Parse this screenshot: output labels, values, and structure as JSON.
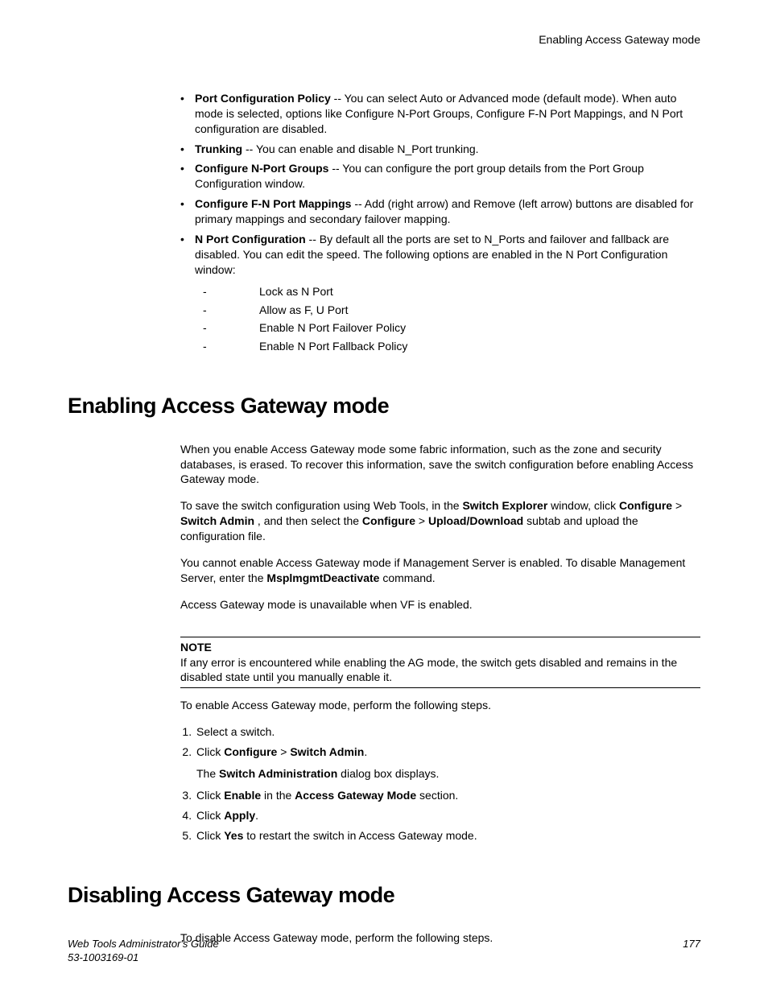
{
  "runningHeader": "Enabling Access Gateway mode",
  "bullets": {
    "b1_label": "Port Configuration Policy",
    "b1_text": " -- You can select Auto or Advanced mode (default mode). When auto mode is selected, options like Configure N-Port Groups, Configure F-N Port Mappings, and N Port configuration are disabled.",
    "b2_label": "Trunking",
    "b2_text": " -- You can enable and disable N_Port trunking.",
    "b3_label": "Configure N-Port Groups",
    "b3_text": " -- You can configure the port group details from the Port Group Configuration window.",
    "b4_label": "Configure F-N Port Mappings",
    "b4_text": " -- Add (right arrow) and Remove (left arrow) buttons are disabled for primary mappings and secondary failover mapping.",
    "b5_label": "N Port Configuration",
    "b5_text": " -- By default all the ports are set to N_Ports and failover and fallback are disabled. You can edit the speed. The following options are enabled in the N Port Configuration window:",
    "sub1": "Lock as N Port",
    "sub2": "Allow as F, U Port",
    "sub3": "Enable N Port Failover Policy",
    "sub4": "Enable N Port Fallback Policy"
  },
  "h1a": "Enabling Access Gateway mode",
  "enable": {
    "p1": "When you enable Access Gateway mode some fabric information, such as the zone and security databases, is erased. To recover this information, save the switch configuration before enabling Access Gateway mode.",
    "p2_a": "To save the switch configuration using Web Tools, in the ",
    "p2_b1": "Switch Explorer",
    "p2_c": " window, click ",
    "p2_b2": "Configure ",
    "p2_gt1": " > ",
    "p2_b3": "Switch Admin",
    "p2_d": " , and then select the ",
    "p2_b4": "Configure ",
    "p2_gt2": " > ",
    "p2_b5": "Upload/Download",
    "p2_e": " subtab and upload the configuration file.",
    "p3_a": "You cannot enable Access Gateway mode if Management Server is enabled. To disable Management Server, enter the ",
    "p3_b": "MsplmgmtDeactivate",
    "p3_c": " command.",
    "p4": "Access Gateway mode is unavailable when VF is enabled.",
    "noteLabel": "NOTE",
    "noteText": "If any error is encountered while enabling the AG mode, the switch gets disabled and remains in the disabled state until you manually enable it.",
    "stepsIntro": "To enable Access Gateway mode, perform the following steps.",
    "s1": "Select a switch.",
    "s2_a": "Click ",
    "s2_b1": "Configure ",
    "s2_gt": " > ",
    "s2_b2": "Switch Admin",
    "s2_c": ".",
    "s2_sub_a": "The ",
    "s2_sub_b": "Switch Administration",
    "s2_sub_c": " dialog box displays.",
    "s3_a": "Click ",
    "s3_b1": "Enable",
    "s3_c": " in the ",
    "s3_b2": "Access Gateway Mode",
    "s3_d": " section.",
    "s4_a": "Click ",
    "s4_b": "Apply",
    "s4_c": ".",
    "s5_a": "Click ",
    "s5_b": "Yes",
    "s5_c": " to restart the switch in Access Gateway mode."
  },
  "h1b": "Disabling Access Gateway mode",
  "disable": {
    "p1": "To disable Access Gateway mode, perform the following steps."
  },
  "footer": {
    "title": "Web Tools Administrator's Guide",
    "docnum": "53-1003169-01",
    "page": "177"
  }
}
